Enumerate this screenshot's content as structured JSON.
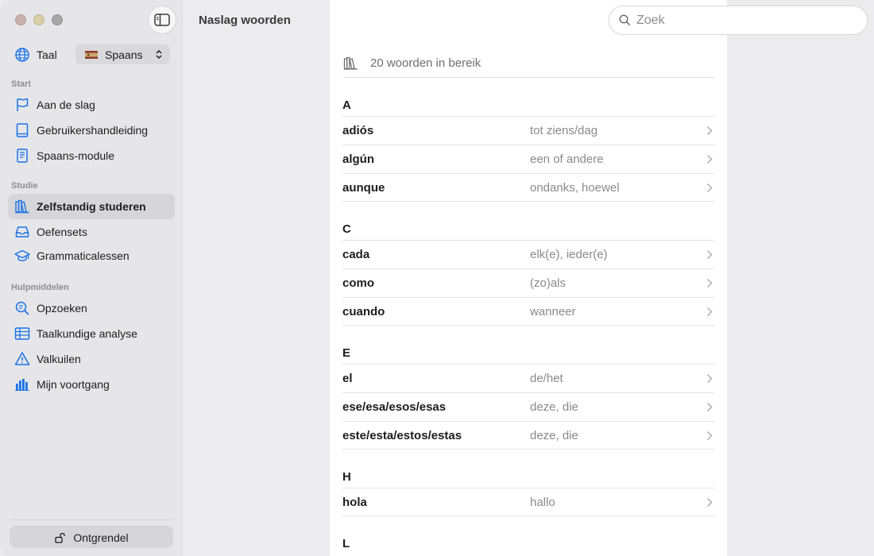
{
  "toolbar": {
    "title": "Naslag woorden",
    "search_placeholder": "Zoek"
  },
  "sidebar": {
    "language_label": "Taal",
    "language_value": "Spaans",
    "sections": [
      {
        "title": "Start",
        "items": [
          "Aan de slag",
          "Gebruikershandleiding",
          "Spaans-module"
        ]
      },
      {
        "title": "Studie",
        "items": [
          "Zelfstandig studeren",
          "Oefensets",
          "Grammaticalessen"
        ]
      },
      {
        "title": "Hulpmiddelen",
        "items": [
          "Opzoeken",
          "Taalkundige analyse",
          "Valkuilen",
          "Mijn voortgang"
        ]
      }
    ],
    "active_item": "Zelfstandig studeren",
    "unlock_label": "Ontgrendel"
  },
  "main": {
    "count_text": "20 woorden in bereik",
    "groups": [
      {
        "letter": "A",
        "rows": [
          {
            "word": "adiós",
            "translation": "tot ziens/dag"
          },
          {
            "word": "algún",
            "translation": "een of andere"
          },
          {
            "word": "aunque",
            "translation": "ondanks, hoewel"
          }
        ]
      },
      {
        "letter": "C",
        "rows": [
          {
            "word": "cada",
            "translation": "elk(e), ieder(e)"
          },
          {
            "word": "como",
            "translation": "(zo)als"
          },
          {
            "word": "cuando",
            "translation": "wanneer"
          }
        ]
      },
      {
        "letter": "E",
        "rows": [
          {
            "word": "el",
            "translation": "de/het"
          },
          {
            "word": "ese/esa/esos/esas",
            "translation": "deze, die"
          },
          {
            "word": "este/esta/estos/estas",
            "translation": "deze, die"
          }
        ]
      },
      {
        "letter": "H",
        "rows": [
          {
            "word": "hola",
            "translation": "hallo"
          }
        ]
      },
      {
        "letter": "L",
        "rows": []
      }
    ]
  },
  "colors": {
    "accent": "#1a73e8",
    "sidebar_bg": "#e6e6e9",
    "content_bg": "#ffffff"
  }
}
